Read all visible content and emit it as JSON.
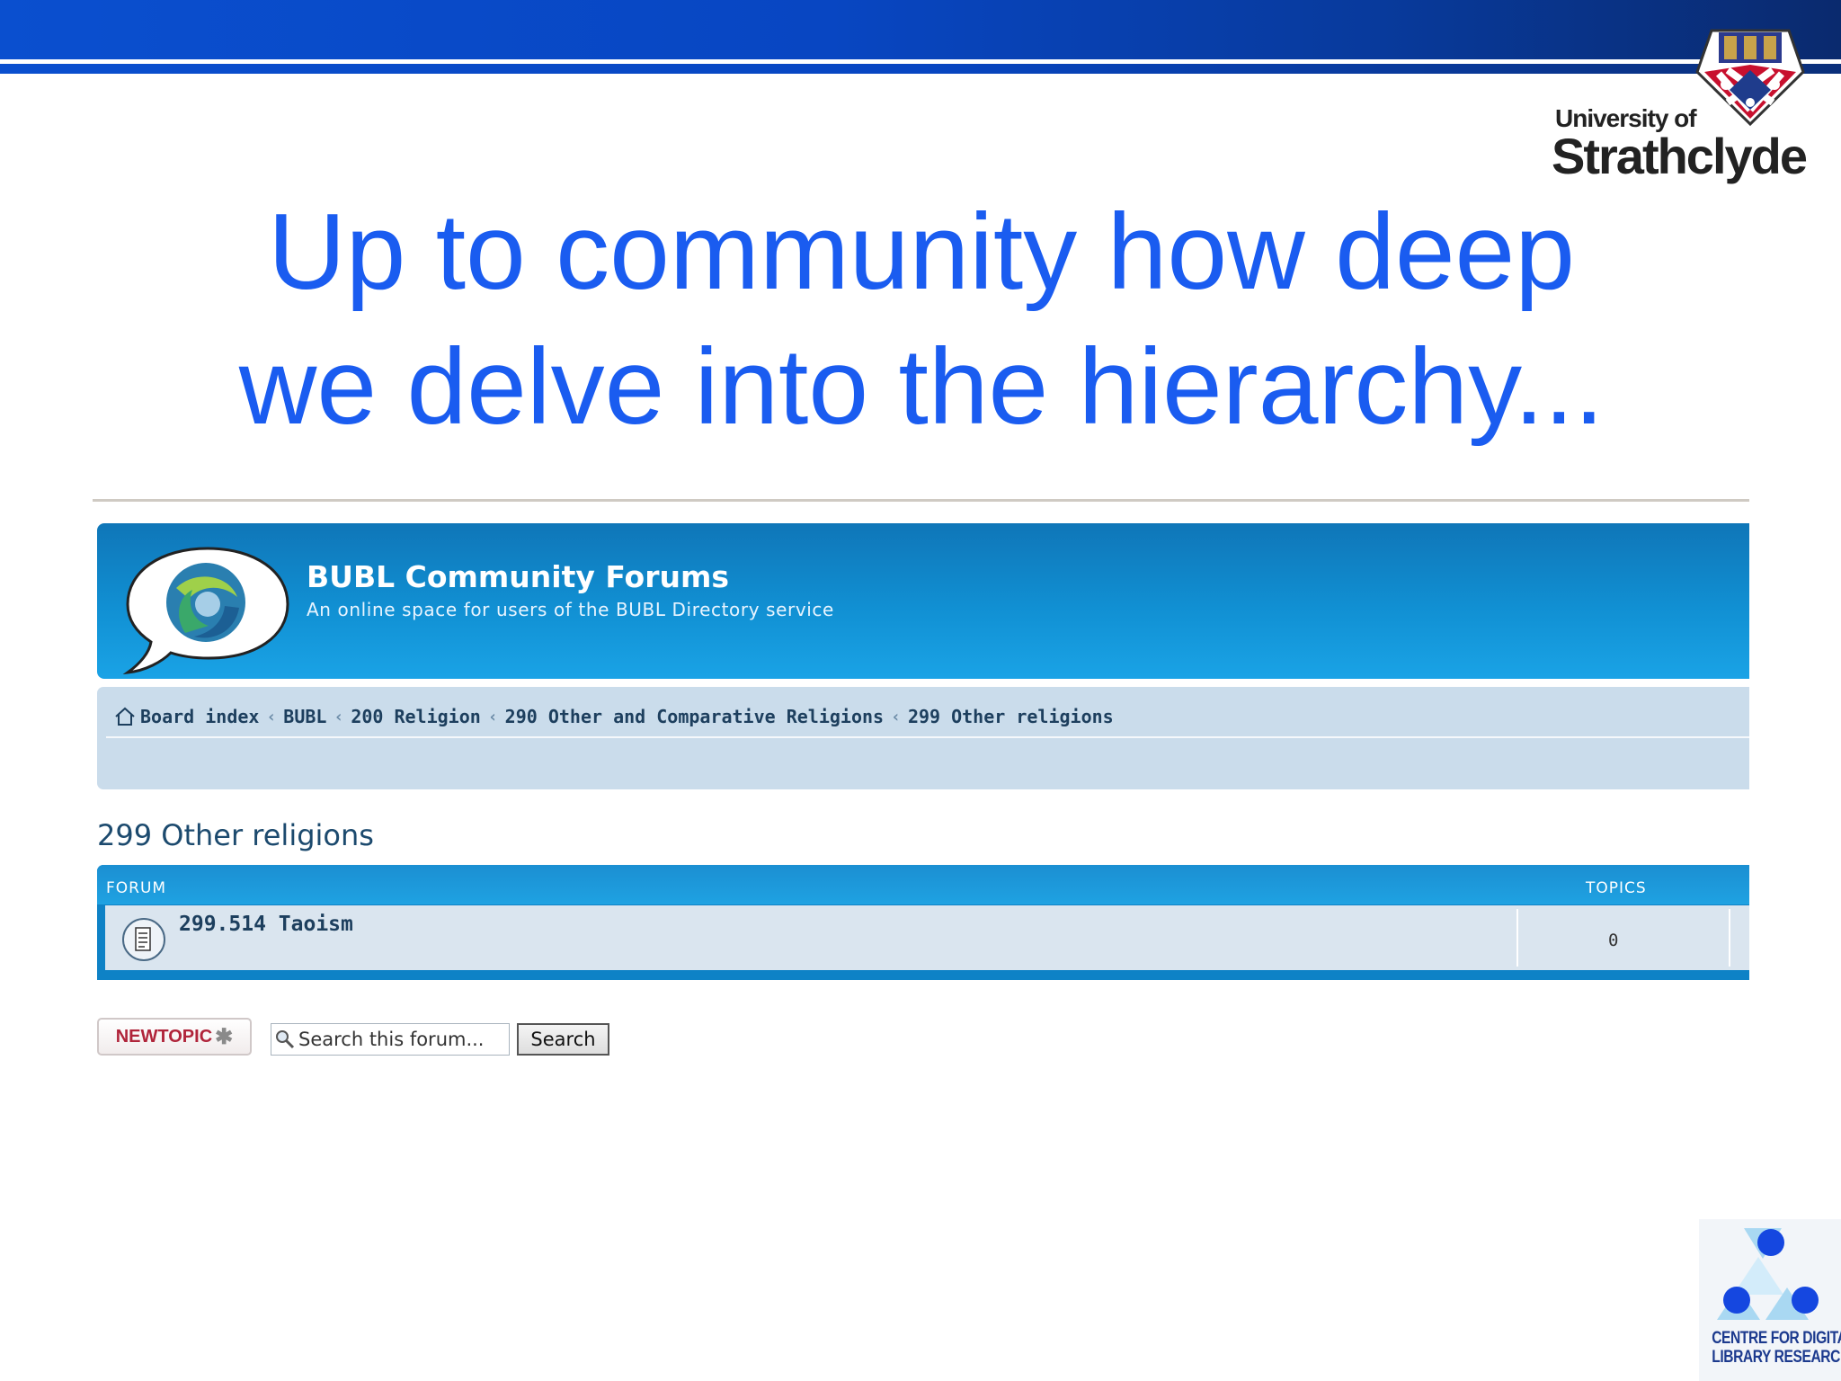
{
  "slide": {
    "title_line1": "Up to community how deep",
    "title_line2": "we delve into the hierarchy..."
  },
  "university_logo": {
    "line1": "University of",
    "line2": "Strathclyde"
  },
  "forum": {
    "site_title": "BUBL Community Forums",
    "site_description": "An online space for users of the BUBL Directory service",
    "breadcrumbs": [
      "Board index",
      "BUBL",
      "200 Religion",
      "290 Other and Comparative Religions",
      "299 Other religions"
    ],
    "breadcrumb_separator": "‹",
    "heading": "299 Other religions",
    "table": {
      "col_forum": "FORUM",
      "col_topics": "TOPICS",
      "rows": [
        {
          "title": "299.514 Taoism",
          "topics": "0"
        }
      ]
    },
    "actions": {
      "newtopic_label": "NEWTOPIC",
      "newtopic_star": "✱",
      "search_placeholder": "Search this forum...",
      "search_button": "Search"
    }
  },
  "cdlr_logo": {
    "line1": "CENTRE FOR DIGITAL",
    "line2": "LIBRARY RESEARCH"
  },
  "colors": {
    "title_blue": "#1a5cf0",
    "banner_blue": "#0846c2",
    "forum_header": "#1190d3",
    "navbar_bg": "#cadceb",
    "newtopic_red": "#b0243a"
  }
}
